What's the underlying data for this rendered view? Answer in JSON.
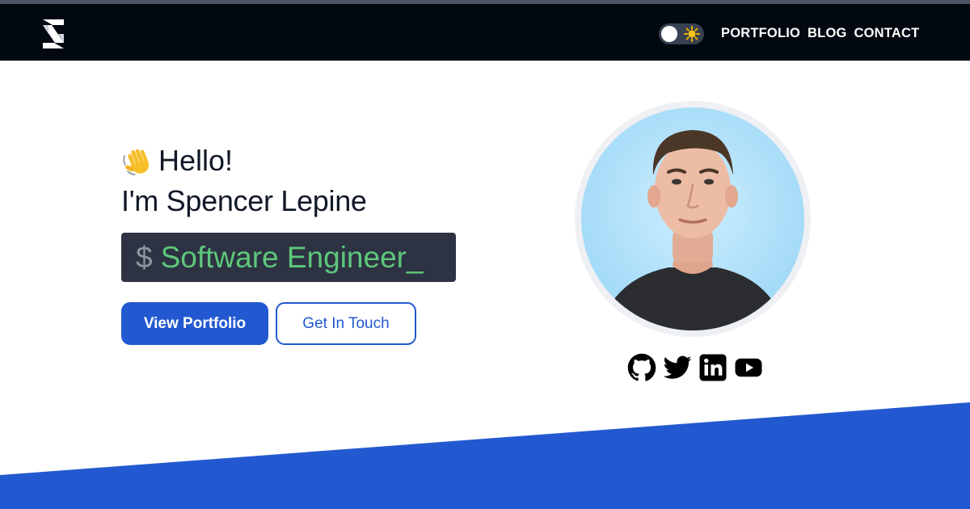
{
  "nav": {
    "links": [
      "PORTFOLIO",
      "BLOG",
      "CONTACT"
    ],
    "theme_toggle": {
      "state": "light",
      "icon": "sun-icon"
    }
  },
  "hero": {
    "greeting": "Hello!",
    "greeting_icon": "waving-hand-icon",
    "name": "I'm Spencer Lepine",
    "terminal": {
      "prompt": "$",
      "text": "Software Engineer_"
    },
    "primary_button": "View Portfolio",
    "secondary_button": "Get In Touch"
  },
  "social_icons": [
    "github-icon",
    "twitter-icon",
    "linkedin-icon",
    "youtube-icon"
  ],
  "colors": {
    "navbar_bg": "#020810",
    "accent": "#2359d0",
    "terminal_bg": "#2d3342",
    "terminal_text": "#5ec77c",
    "text_dark": "#111827"
  }
}
